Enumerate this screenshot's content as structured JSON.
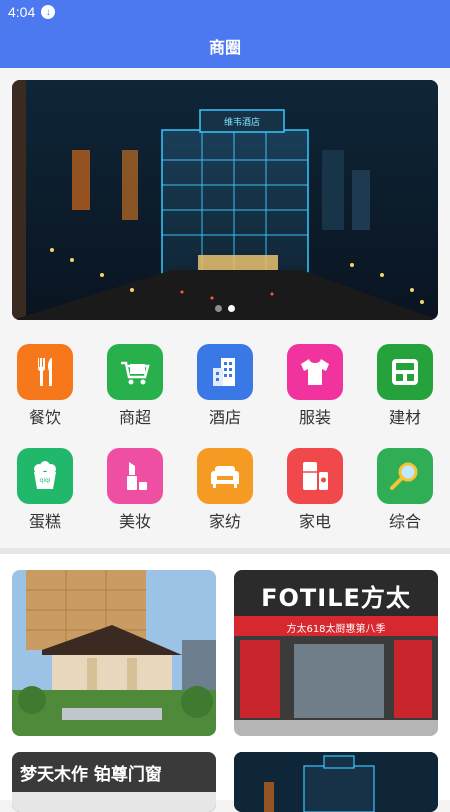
{
  "status_bar": {
    "time": "4:04",
    "download_icon": "download-icon"
  },
  "app_bar": {
    "title": "商圈"
  },
  "banner": {
    "hotel_sign": "维韦酒店",
    "dots": 2,
    "active_dot": 1
  },
  "categories": [
    {
      "label": "餐饮",
      "icon": "utensils-icon",
      "color": "#f6781a"
    },
    {
      "label": "商超",
      "icon": "shopping-cart-icon",
      "color": "#27b04b"
    },
    {
      "label": "酒店",
      "icon": "building-icon",
      "color": "#3a78e6"
    },
    {
      "label": "服装",
      "icon": "tshirt-icon",
      "color": "#f0339d"
    },
    {
      "label": "建材",
      "icon": "building-material-icon",
      "color": "#26a23d"
    },
    {
      "label": "蛋糕",
      "icon": "cake-icon",
      "color": "#22b86c"
    },
    {
      "label": "美妆",
      "icon": "lipstick-icon",
      "color": "#ef4fa3"
    },
    {
      "label": "家纺",
      "icon": "sofa-icon",
      "color": "#f59a22"
    },
    {
      "label": "家电",
      "icon": "refrigerator-icon",
      "color": "#f0484b"
    },
    {
      "label": "综合",
      "icon": "magnifier-icon",
      "color": "#2fae55"
    }
  ],
  "cards": [
    {
      "name": "hotel-card",
      "text": ""
    },
    {
      "name": "fotile-card",
      "text": "FOTILE方太",
      "sub": "方太618太厨惠第八季"
    },
    {
      "name": "doors-card",
      "text": "梦天木作  铂尊门窗"
    },
    {
      "name": "night-hotel-card",
      "text": ""
    }
  ]
}
